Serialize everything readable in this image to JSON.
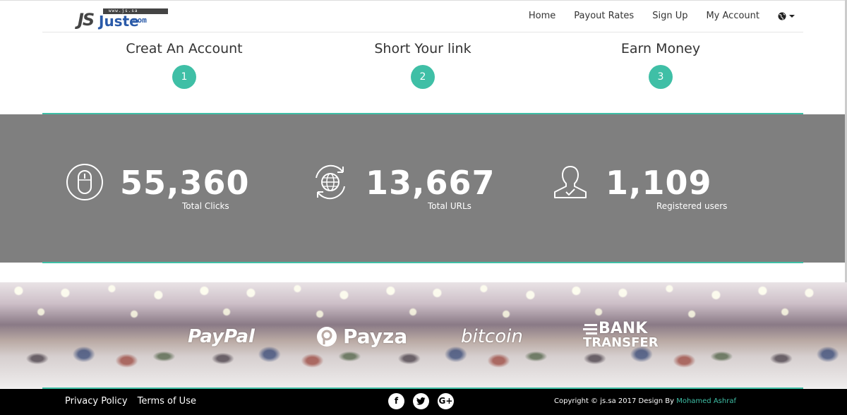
{
  "logo": {
    "prefix": "JS",
    "word": "Juste",
    "tld": "com",
    "url_text": "www.js.sa"
  },
  "nav": {
    "home": "Home",
    "payout_rates": "Payout Rates",
    "sign_up": "Sign Up",
    "my_account": "My Account"
  },
  "steps": [
    {
      "title": "Creat An Account",
      "number": "1"
    },
    {
      "title": "Short Your link",
      "number": "2"
    },
    {
      "title": "Earn Money",
      "number": "3"
    }
  ],
  "stats": [
    {
      "value": "55,360",
      "label": "Total Clicks",
      "icon": "mouse-icon"
    },
    {
      "value": "13,667",
      "label": "Total URLs",
      "icon": "globe-refresh-icon"
    },
    {
      "value": "1,109",
      "label": "Registered users",
      "icon": "user-check-icon"
    }
  ],
  "payments": {
    "paypal": "PayPal",
    "payza": "Payza",
    "bitcoin": "bitcoin",
    "bank_line1": "BANK",
    "bank_line2": "TRANSFER"
  },
  "footer": {
    "privacy": "Privacy Policy",
    "terms": "Terms of Use",
    "copyright": "Copyright © js.sa 2017 Design By",
    "author": "Mohamed Ashraf",
    "social": {
      "facebook": "f",
      "google": "G+"
    }
  },
  "colors": {
    "accent": "#3fbfa6",
    "stats_bg": "#7f7f7f",
    "footer_bg": "#000000"
  }
}
